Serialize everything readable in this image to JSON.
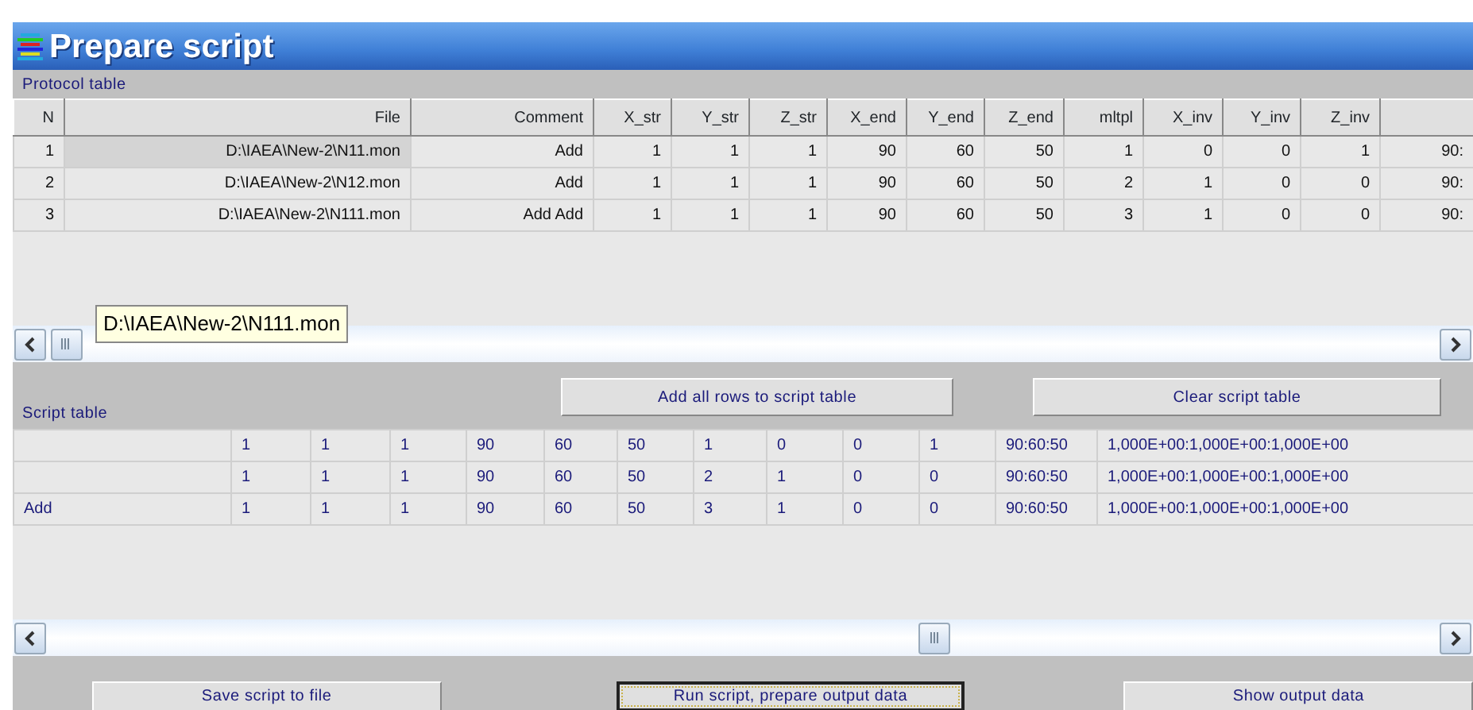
{
  "window": {
    "title": "Prepare script"
  },
  "protocol_table": {
    "label": "Protocol table",
    "columns": [
      "N",
      "File",
      "Comment",
      "X_str",
      "Y_str",
      "Z_str",
      "X_end",
      "Y_end",
      "Z_end",
      "mltpl",
      "X_inv",
      "Y_inv",
      "Z_inv"
    ],
    "rows": [
      {
        "file_focused": true,
        "cells": [
          "1",
          "D:\\IAEA\\New-2\\N11.mon",
          "Add",
          "1",
          "1",
          "1",
          "90",
          "60",
          "50",
          "1",
          "0",
          "0",
          "1",
          "90:"
        ]
      },
      {
        "file_focused": false,
        "cells": [
          "2",
          "D:\\IAEA\\New-2\\N12.mon",
          "Add",
          "1",
          "1",
          "1",
          "90",
          "60",
          "50",
          "2",
          "1",
          "0",
          "0",
          "90:"
        ]
      },
      {
        "file_focused": false,
        "cells": [
          "3",
          "D:\\IAEA\\New-2\\N111.mon",
          "Add Add",
          "1",
          "1",
          "1",
          "90",
          "60",
          "50",
          "3",
          "1",
          "0",
          "0",
          "90:"
        ]
      }
    ],
    "tooltip": "D:\\IAEA\\New-2\\N111.mon"
  },
  "middle_buttons": [
    "Add all rows to script table",
    "Clear script table"
  ],
  "script_table": {
    "label": "Script table",
    "rows": [
      {
        "cells": [
          "1",
          "1",
          "1",
          "90",
          "60",
          "50",
          "1",
          "0",
          "0",
          "1",
          "90:60:50",
          "1,000E+00:1,000E+00:1,000E+00"
        ]
      },
      {
        "cells": [
          "1",
          "1",
          "1",
          "90",
          "60",
          "50",
          "2",
          "1",
          "0",
          "0",
          "90:60:50",
          "1,000E+00:1,000E+00:1,000E+00"
        ]
      },
      {
        "comment": "Add",
        "cells": [
          "1",
          "1",
          "1",
          "90",
          "60",
          "50",
          "3",
          "1",
          "0",
          "0",
          "90:60:50",
          "1,000E+00:1,000E+00:1,000E+00"
        ]
      }
    ]
  },
  "bottom_buttons": [
    {
      "label": "Save script to file",
      "focused": false
    },
    {
      "label": "Run script, prepare output data",
      "focused": true
    },
    {
      "label": "Show output data",
      "focused": false
    }
  ]
}
